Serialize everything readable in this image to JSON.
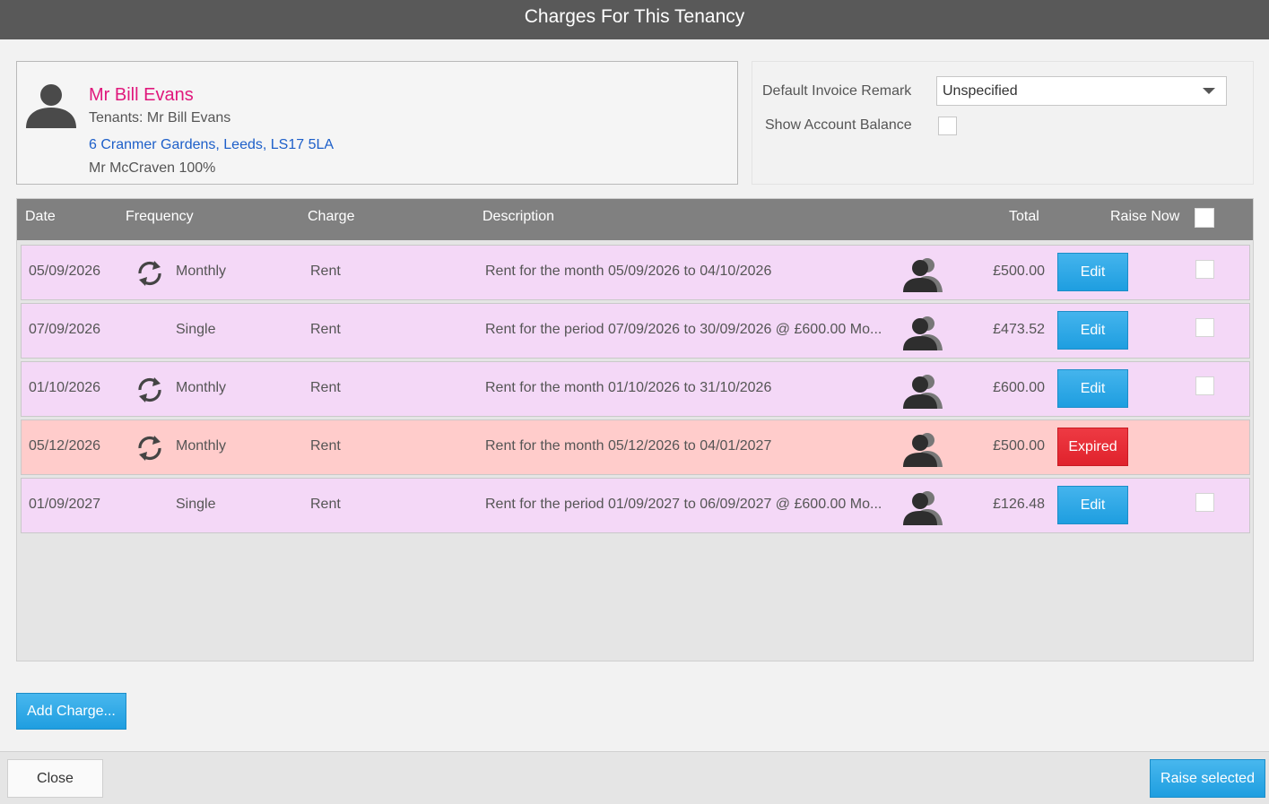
{
  "window": {
    "title": "Charges For This Tenancy"
  },
  "tenant": {
    "name": "Mr Bill Evans",
    "tenants_line": "Tenants: Mr Bill Evans",
    "address": "6 Cranmer Gardens, Leeds, LS17 5LA",
    "owner_line": "Mr McCraven 100%"
  },
  "options": {
    "remark_label": "Default Invoice Remark",
    "remark_value": "Unspecified",
    "balance_label": "Show Account Balance",
    "balance_checked": false
  },
  "grid": {
    "columns": {
      "date": "Date",
      "frequency": "Frequency",
      "charge": "Charge",
      "description": "Description",
      "total": "Total",
      "raise_now": "Raise Now"
    },
    "rows": [
      {
        "date": "05/09/2026",
        "recurring": true,
        "frequency": "Monthly",
        "charge": "Rent",
        "description": "Rent for the month 05/09/2026 to 04/10/2026",
        "total": "£500.00",
        "action": "Edit",
        "expired": false
      },
      {
        "date": "07/09/2026",
        "recurring": false,
        "frequency": "Single",
        "charge": "Rent",
        "description": "Rent for the period 07/09/2026 to 30/09/2026 @ £600.00 Mo...",
        "total": "£473.52",
        "action": "Edit",
        "expired": false
      },
      {
        "date": "01/10/2026",
        "recurring": true,
        "frequency": "Monthly",
        "charge": "Rent",
        "description": "Rent for the month 01/10/2026 to 31/10/2026",
        "total": "£600.00",
        "action": "Edit",
        "expired": false
      },
      {
        "date": "05/12/2026",
        "recurring": true,
        "frequency": "Monthly",
        "charge": "Rent",
        "description": "Rent for the month 05/12/2026 to 04/01/2027",
        "total": "£500.00",
        "action": "Expired",
        "expired": true
      },
      {
        "date": "01/09/2027",
        "recurring": false,
        "frequency": "Single",
        "charge": "Rent",
        "description": "Rent for the period 01/09/2027 to 06/09/2027 @ £600.00 Mo...",
        "total": "£126.48",
        "action": "Edit",
        "expired": false
      }
    ]
  },
  "buttons": {
    "add_charge": "Add Charge...",
    "close": "Close",
    "raise_selected": "Raise selected"
  },
  "colors": {
    "accent_blue": "#1e9ee0",
    "expired_red": "#e0222c",
    "row_pink": "#f4d8f7",
    "row_expired": "#ffcccb",
    "name_magenta": "#e0187c",
    "link_blue": "#1d5fc9"
  }
}
